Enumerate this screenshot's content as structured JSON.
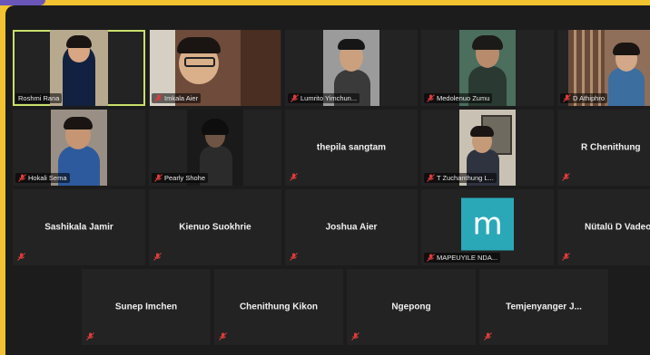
{
  "accent_colors": {
    "frame": "#f2c230",
    "active_speaker_border": "#c9e06a",
    "muted_mic": "#e03c3c",
    "avatar_bg": "#2aa8b8"
  },
  "participants": [
    {
      "name": "Roshmi Rana",
      "label": "Roshmi Rana",
      "video": true,
      "active": true
    },
    {
      "name": "Imkala Aier",
      "label": "Imkala Aier",
      "video": true
    },
    {
      "name": "Lumrito Yimchunger",
      "label": "Lumrito Yimchun...",
      "video": true
    },
    {
      "name": "Medolenuo Zumu",
      "label": "Medolenuo Zumu",
      "video": true
    },
    {
      "name": "D Athiphro",
      "label": "D Athiphro",
      "video": true
    },
    {
      "name": "Hokali Sema",
      "label": "Hokali Sema",
      "video": true
    },
    {
      "name": "Pearly Shohe",
      "label": "Pearly Shohe",
      "video": true
    },
    {
      "name": "thepila sangtam",
      "label": "",
      "video": false
    },
    {
      "name": "T Zuchanthung Lotha",
      "label": "T Zuchanthung L...",
      "video": true
    },
    {
      "name": "R Chenithung",
      "label": "",
      "video": false
    },
    {
      "name": "Sashikala Jamir",
      "label": "",
      "video": false
    },
    {
      "name": "Kienuo Suokhrie",
      "label": "",
      "video": false
    },
    {
      "name": "Joshua Aier",
      "label": "",
      "video": false
    },
    {
      "name": "MAPEUYILE NDANG",
      "label": "MAPEUYILE NDA...",
      "video": false,
      "avatar": "m"
    },
    {
      "name": "Nütalü D Vadeo",
      "label": "",
      "video": false
    },
    {
      "name": "Sunep Imchen",
      "label": "",
      "video": false
    },
    {
      "name": "Chenithung Kikon",
      "label": "",
      "video": false
    },
    {
      "name": "Ngepong",
      "label": "",
      "video": false
    },
    {
      "name": "Temjenyanger J...",
      "label": "",
      "video": false
    }
  ]
}
